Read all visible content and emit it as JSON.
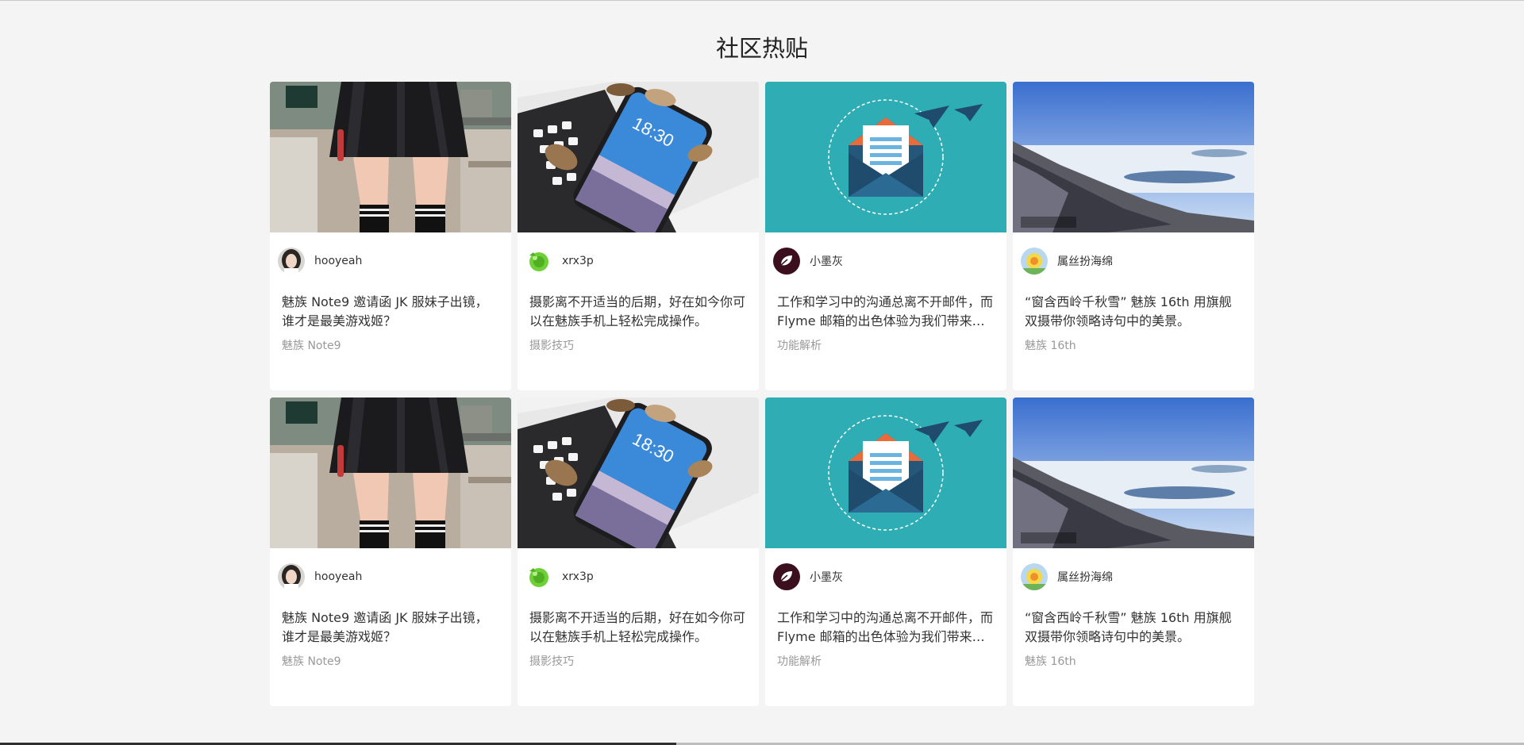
{
  "page": {
    "title": "社区热贴"
  },
  "posts": [
    {
      "image": "photo-girl-uniform",
      "avatar": "avatar-hooyeah",
      "author": "hooyeah",
      "title": "魅族 Note9 邀请函 JK 服妹子出镜，谁才是最美游戏姬？",
      "tag": "魅族 Note9"
    },
    {
      "image": "photo-phone-keyboard",
      "avatar": "avatar-xrx3p",
      "author": "xrx3p",
      "title": "摄影离不开适当的后期，好在如今你可以在魅族手机上轻松完成操作。",
      "tag": "摄影技巧"
    },
    {
      "image": "illustration-mail-envelope",
      "avatar": "avatar-xiaomohui",
      "author": "小墨灰",
      "title": "工作和学习中的沟通总离不开邮件，而 Flyme 邮箱的出色体验为我们带来的便利",
      "tag": "功能解析"
    },
    {
      "image": "photo-snow-mountain",
      "avatar": "avatar-shusi",
      "author": "属丝扮海绵",
      "title": "“窗含西岭千秋雪” 魅族 16th 用旗舰双摄带你领略诗句中的美景。",
      "tag": "魅族 16th"
    },
    {
      "image": "photo-girl-uniform",
      "avatar": "avatar-hooyeah",
      "author": "hooyeah",
      "title": "魅族 Note9 邀请函 JK 服妹子出镜，谁才是最美游戏姬？",
      "tag": "魅族 Note9"
    },
    {
      "image": "photo-phone-keyboard",
      "avatar": "avatar-xrx3p",
      "author": "xrx3p",
      "title": "摄影离不开适当的后期，好在如今你可以在魅族手机上轻松完成操作。",
      "tag": "摄影技巧"
    },
    {
      "image": "illustration-mail-envelope",
      "avatar": "avatar-xiaomohui",
      "author": "小墨灰",
      "title": "工作和学习中的沟通总离不开邮件，而 Flyme 邮箱的出色体验为我们带来的便利",
      "tag": "功能解析"
    },
    {
      "image": "photo-snow-mountain",
      "avatar": "avatar-shusi",
      "author": "属丝扮海绵",
      "title": "“窗含西岭千秋雪” 魅族 16th 用旗舰双摄带你领略诗句中的美景。",
      "tag": "魅族 16th"
    }
  ],
  "colors": {
    "background": "#f4f4f4",
    "card": "#ffffff",
    "title_text": "#333333",
    "tag_text": "#999999",
    "mail_teal": "#2eadb4",
    "sky_blue": "#4a7fd0"
  }
}
